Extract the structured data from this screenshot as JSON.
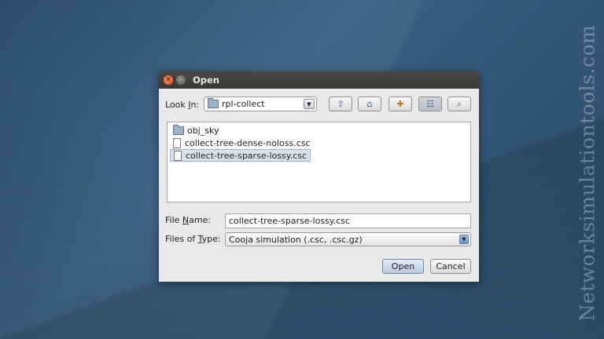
{
  "watermark": "Networksimulationtools.com",
  "dialog": {
    "title": "Open",
    "window_buttons": {
      "close_icon": "close-icon",
      "minimize_icon": "minimize-icon"
    },
    "look_in": {
      "label_prefix": "Look ",
      "label_mnemonic": "I",
      "label_suffix": "n:",
      "value": "rpl-collect",
      "icon": "folder-icon"
    },
    "toolbar": [
      {
        "name": "up-one-level-button",
        "icon": "folder-up-icon",
        "glyph": "⇧"
      },
      {
        "name": "home-button",
        "icon": "home-icon",
        "glyph": "⌂"
      },
      {
        "name": "new-folder-button",
        "icon": "new-folder-icon",
        "glyph": "✚"
      },
      {
        "name": "list-view-button",
        "icon": "list-view-icon",
        "glyph": "☷"
      },
      {
        "name": "details-view-button",
        "icon": "details-view-icon",
        "glyph": "⌕"
      }
    ],
    "files": [
      {
        "name": "obj_sky",
        "type": "folder",
        "selected": false
      },
      {
        "name": "collect-tree-dense-noloss.csc",
        "type": "file",
        "selected": false
      },
      {
        "name": "collect-tree-sparse-lossy.csc",
        "type": "file",
        "selected": true
      }
    ],
    "file_name": {
      "label_prefix": "File ",
      "label_mnemonic": "N",
      "label_suffix": "ame:",
      "value": "collect-tree-sparse-lossy.csc"
    },
    "file_type": {
      "label_prefix": "Files of ",
      "label_mnemonic": "T",
      "label_suffix": "ype:",
      "value": "Cooja simulation (.csc, .csc.gz)"
    },
    "buttons": {
      "open": "Open",
      "cancel": "Cancel"
    }
  }
}
